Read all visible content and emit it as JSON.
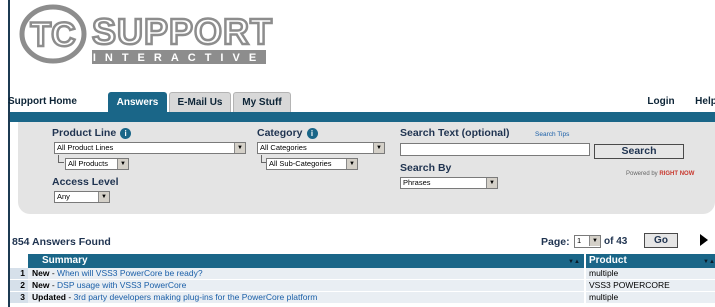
{
  "logo": {
    "brand_initials": "TC",
    "brand_word": "SUPPORT",
    "brand_sub": "INTERACTIVE"
  },
  "tabs": {
    "home": "Support Home",
    "answers": "Answers",
    "email": "E-Mail Us",
    "mystuff": "My Stuff",
    "login": "Login",
    "help": "Help",
    "active": "Answers"
  },
  "search_panel": {
    "product_line_label": "Product Line",
    "product_line_value": "All Product Lines",
    "products_value": "All Products",
    "category_label": "Category",
    "category_value": "All Categories",
    "subcategory_value": "All Sub-Categories",
    "access_level_label": "Access Level",
    "access_level_value": "Any",
    "search_text_label": "Search Text (optional)",
    "search_text_value": "",
    "search_tips_link": "Search Tips",
    "search_by_label": "Search By",
    "search_by_value": "Phrases",
    "search_button": "Search",
    "powered_by": "Powered by",
    "powered_brand": "RIGHT NOW"
  },
  "results": {
    "count_label": "854 Answers Found",
    "page_label": "Page:",
    "page_value": "1",
    "page_of": "of 43",
    "go_button": "Go"
  },
  "table": {
    "headers": {
      "summary": "Summary",
      "product": "Product"
    },
    "rows": [
      {
        "num": "1",
        "status": "New",
        "title": "When will VSS3 PowerCore be ready?",
        "product": "multiple"
      },
      {
        "num": "2",
        "status": "New",
        "title": "DSP usage with VSS3 PowerCore",
        "product": "VSS3 POWERCORE"
      },
      {
        "num": "3",
        "status": "Updated",
        "title": "3rd party developers making plug-ins for the PowerCore platform",
        "product": "multiple"
      }
    ]
  },
  "colors": {
    "accent_blue": "#1a6688",
    "panel_gray": "#e4e4e4",
    "link_blue": "#1a5fa8",
    "logo_gray": "#8d8d8d"
  }
}
